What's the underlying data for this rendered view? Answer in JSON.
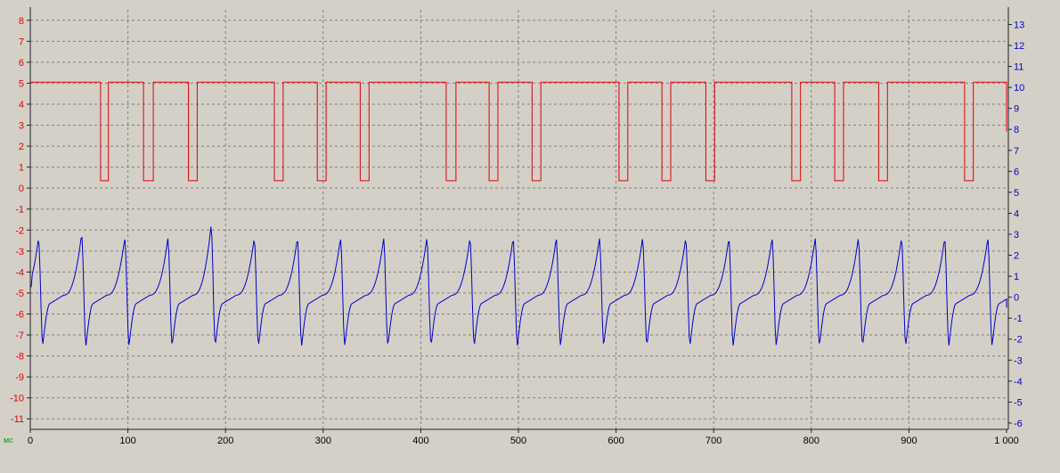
{
  "chart_data": {
    "type": "line",
    "title": "",
    "xlabel": "мс",
    "xlim": [
      0,
      1000
    ],
    "x_ticks": [
      {
        "value": 0,
        "label": "0"
      },
      {
        "value": 100,
        "label": "100"
      },
      {
        "value": 200,
        "label": "200"
      },
      {
        "value": 300,
        "label": "300"
      },
      {
        "value": 400,
        "label": "400"
      },
      {
        "value": 500,
        "label": "500"
      },
      {
        "value": 600,
        "label": "600"
      },
      {
        "value": 700,
        "label": "700"
      },
      {
        "value": 800,
        "label": "800"
      },
      {
        "value": 900,
        "label": "900"
      },
      {
        "value": 1000,
        "label": "1 000"
      }
    ],
    "left_axis": {
      "color": "#e00000",
      "ylim": [
        -11.5,
        8.5
      ],
      "ticks": [
        8,
        7,
        6,
        5,
        4,
        3,
        2,
        1,
        0,
        -1,
        -2,
        -3,
        -4,
        -5,
        -6,
        -7,
        -8,
        -9,
        -10,
        -11
      ]
    },
    "right_axis": {
      "color": "#0000cc",
      "ylim": [
        -6.3,
        13.7
      ],
      "ticks": [
        13,
        12,
        11,
        10,
        9,
        8,
        7,
        6,
        5,
        4,
        3,
        2,
        1,
        0,
        -1,
        -2,
        -3,
        -4,
        -5,
        -6
      ]
    },
    "grid": true,
    "background": "#d4d0c8",
    "plot_background": "#d4d0c8",
    "series": [
      {
        "color": "#e00000",
        "axis": "left",
        "kind": "square-wave",
        "high": 5.05,
        "low": 0.35,
        "start_x": 0,
        "end_x": 1000,
        "end_value": 2.7,
        "low_intervals": [
          [
            72,
            80
          ],
          [
            116,
            126
          ],
          [
            162,
            171
          ],
          [
            250,
            259
          ],
          [
            294,
            303
          ],
          [
            338,
            347
          ],
          [
            426,
            436
          ],
          [
            470,
            479
          ],
          [
            514,
            523
          ],
          [
            603,
            612
          ],
          [
            647,
            656
          ],
          [
            692,
            701
          ],
          [
            780,
            789
          ],
          [
            824,
            833
          ],
          [
            869,
            878
          ],
          [
            957,
            966
          ]
        ]
      },
      {
        "color": "#0000cc",
        "axis": "right",
        "kind": "periodic",
        "period": 44.2,
        "first_peak_x": 8.3,
        "x_step": 1,
        "peak": 2.8,
        "trough": -2.3,
        "plateau": 0.1,
        "start_value": 0.5,
        "end_value": -0.5,
        "peak_overrides": [
          {
            "x": 52,
            "value": 3.0
          },
          {
            "x": 185,
            "value": 3.4
          }
        ]
      }
    ]
  }
}
